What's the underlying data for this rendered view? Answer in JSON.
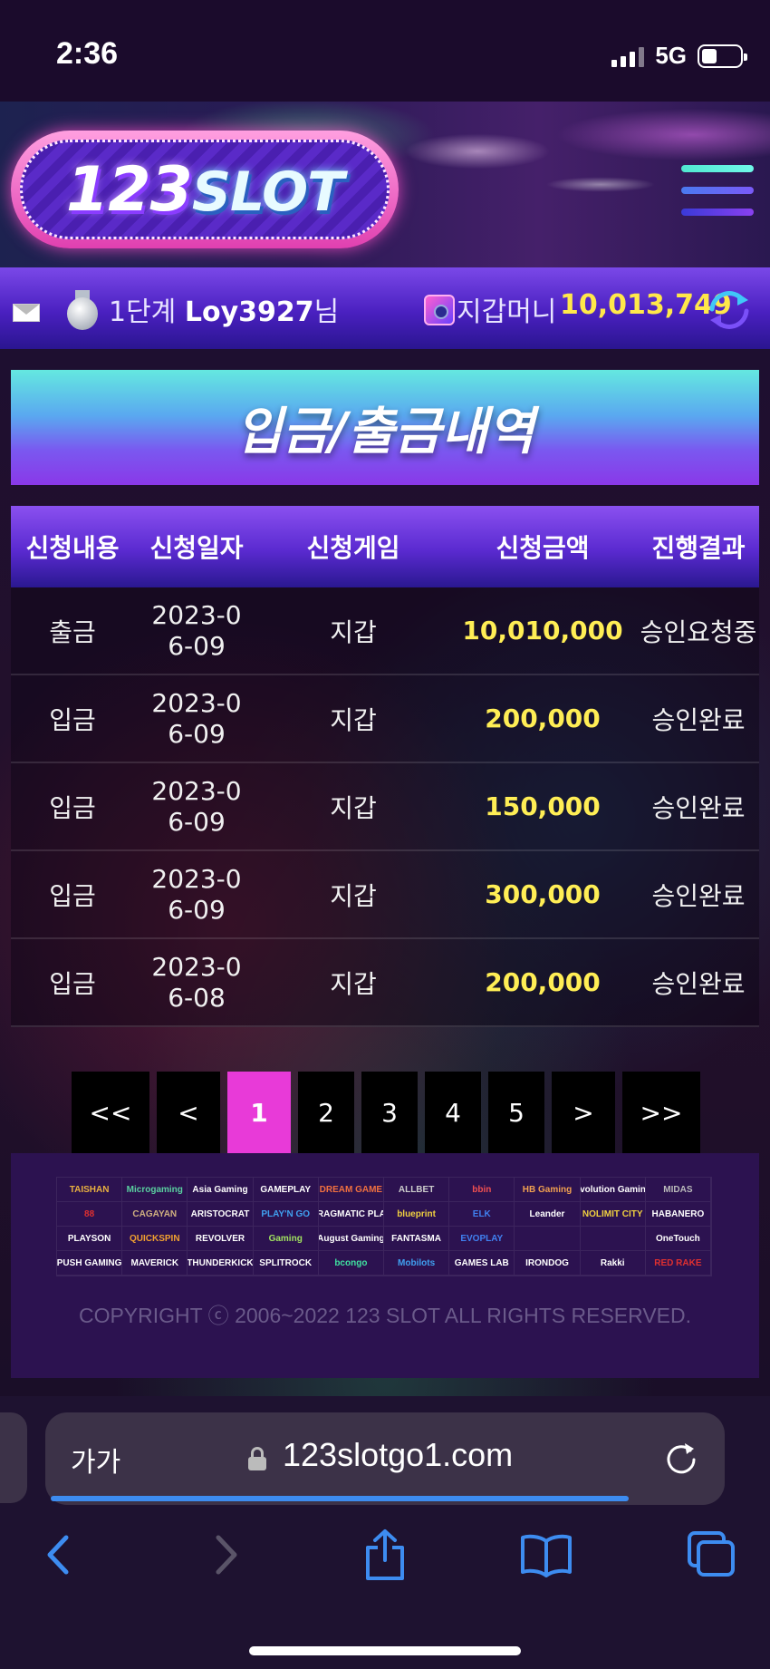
{
  "status_bar": {
    "time": "2:36",
    "network": "5G"
  },
  "header": {
    "logo_number": "123",
    "logo_word": "SLOT"
  },
  "user": {
    "level": "1단계",
    "username": "Loy3927",
    "suffix": "님",
    "wallet_label": "지갑머니",
    "wallet_amount": "10,013,749"
  },
  "page": {
    "title": "입금/출금내역"
  },
  "table": {
    "headers": [
      "신청내용",
      "신청일자",
      "신청게임",
      "신청금액",
      "진행결과"
    ],
    "rows": [
      {
        "type": "출금",
        "date": "2023-06-09",
        "game": "지갑",
        "amount": "10,010,000",
        "result": "승인요청중"
      },
      {
        "type": "입금",
        "date": "2023-06-09",
        "game": "지갑",
        "amount": "200,000",
        "result": "승인완료"
      },
      {
        "type": "입금",
        "date": "2023-06-09",
        "game": "지갑",
        "amount": "150,000",
        "result": "승인완료"
      },
      {
        "type": "입금",
        "date": "2023-06-09",
        "game": "지갑",
        "amount": "300,000",
        "result": "승인완료"
      },
      {
        "type": "입금",
        "date": "2023-06-08",
        "game": "지갑",
        "amount": "200,000",
        "result": "승인완료"
      }
    ]
  },
  "pagination": {
    "first": "<<",
    "prev": "<",
    "pages": [
      "1",
      "2",
      "3",
      "4",
      "5"
    ],
    "next": ">",
    "last": ">>",
    "current": "1"
  },
  "footer": {
    "providers": [
      "TAISHAN",
      "Microgaming",
      "Asia Gaming",
      "GAMEPLAY",
      "DREAM GAME",
      "ALLBET",
      "bbin",
      "HB Gaming",
      "Evolution Gaming",
      "MIDAS",
      "88",
      "CAGAYAN",
      "ARISTOCRAT",
      "PLAY'N GO",
      "PRAGMATIC PLAY",
      "blueprint",
      "ELK",
      "Leander",
      "NOLIMIT CITY",
      "HABANERO",
      "PLAYSON",
      "QUICKSPIN",
      "REVOLVER",
      "Gaming",
      "August Gaming",
      "FANTASMA",
      "EVOPLAY",
      "",
      "",
      "OneTouch",
      "PUSH GAMING",
      "MAVERICK",
      "THUNDERKICK",
      "SPLITROCK",
      "bcongo",
      "Mobilots",
      "GAMES LAB",
      "IRONDOG",
      "Rakki",
      "RED RAKE"
    ],
    "copyright": "COPYRIGHT ⓒ 2006~2022 123 SLOT ALL RIGHTS RESERVED."
  },
  "browser": {
    "text_size": "가가",
    "url": "123slotgo1.com"
  },
  "colors": {
    "accent_pink": "#e83ad8",
    "amount_yellow": "#ffee55",
    "purple": "#5a2ad0"
  }
}
